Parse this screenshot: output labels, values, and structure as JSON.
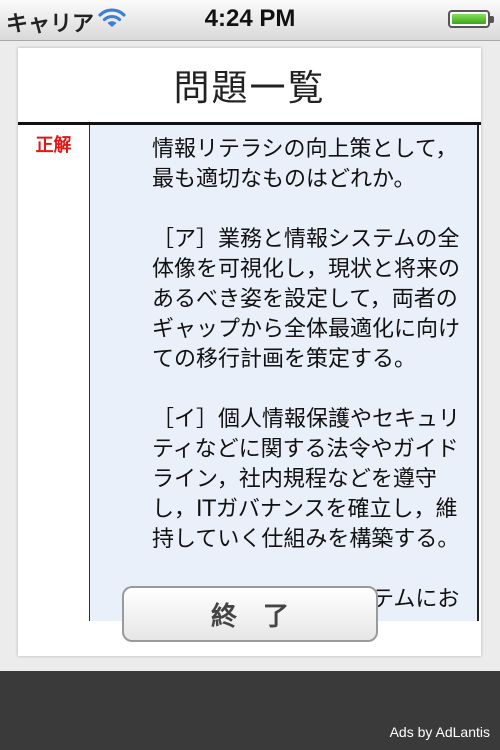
{
  "status": {
    "carrier": "キャリア",
    "time": "4:24 PM"
  },
  "page": {
    "title": "問題一覧"
  },
  "question": {
    "result_label": "正解",
    "stem": "情報リテラシの向上策として，最も適切なものはどれか。",
    "choice_a": "［ア］業務と情報システムの全体像を可視化し，現状と将来のあるべき姿を設定して，両者のギャップから全体最適化に向けての移行計画を策定する。",
    "choice_i": "［イ］個人情報保護やセキュリティなどに関する法令やガイドライン，社内規程などを遵守し，ITガバナンスを確立し，維持していく仕組みを構築する。",
    "choice_u_partial": "［ウ］自社の情報システムにお"
  },
  "footer": {
    "end_button": "終了"
  },
  "ad": {
    "label": "Ads by AdLantis"
  },
  "icons": [
    "wifi-icon",
    "battery-icon"
  ]
}
